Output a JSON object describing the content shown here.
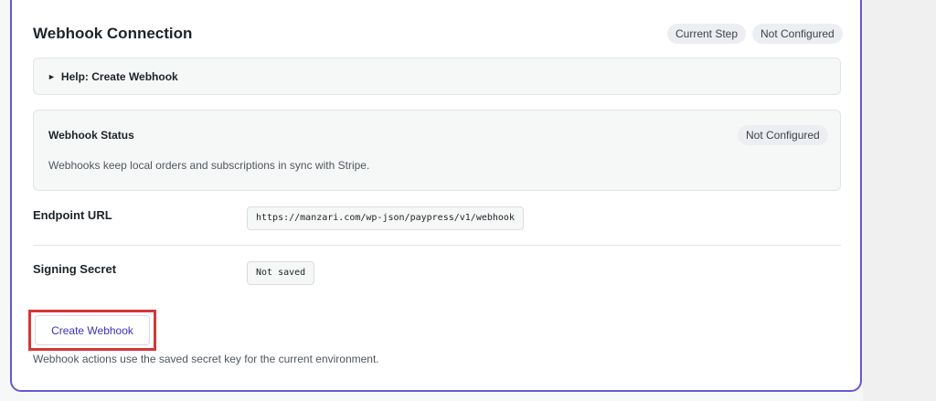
{
  "card": {
    "title": "Webhook Connection",
    "badges": [
      "Current Step",
      "Not Configured"
    ]
  },
  "help": {
    "caret": "►",
    "label": "Help: Create Webhook"
  },
  "status": {
    "title": "Webhook Status",
    "badge": "Not Configured",
    "description": "Webhooks keep local orders and subscriptions in sync with Stripe."
  },
  "endpoint": {
    "label": "Endpoint URL",
    "value": "https://manzari.com/wp-json/paypress/v1/webhook"
  },
  "secret": {
    "label": "Signing Secret",
    "value": "Not saved"
  },
  "actions": {
    "create_label": "Create Webhook",
    "note": "Webhook actions use the saved secret key for the current environment."
  },
  "colors": {
    "accent": "#6657d6",
    "highlight": "#d63638",
    "button_text": "#3b32b8"
  }
}
